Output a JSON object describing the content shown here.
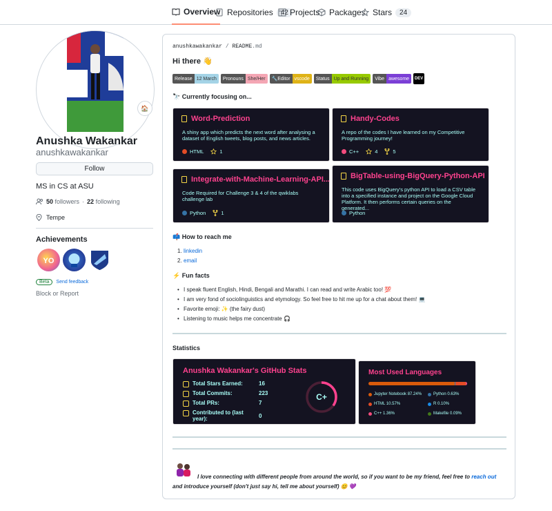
{
  "nav": {
    "tabs": [
      {
        "label": "Overview",
        "icon": "book-icon",
        "count": null
      },
      {
        "label": "Repositories",
        "icon": "repo-icon",
        "count": "42"
      },
      {
        "label": "Projects",
        "icon": "table-icon",
        "count": null
      },
      {
        "label": "Packages",
        "icon": "package-icon",
        "count": null
      },
      {
        "label": "Stars",
        "icon": "star-icon",
        "count": "24"
      }
    ]
  },
  "profile": {
    "name": "Anushka Wakankar",
    "login": "anushkawakankar",
    "follow_label": "Follow",
    "bio": "MS in CS at ASU",
    "followers_count": "50",
    "followers_label": "followers",
    "separator": "·",
    "following_count": "22",
    "following_label": "following",
    "location": "Tempe",
    "achievements_title": "Achievements",
    "beta_label": "Beta",
    "feedback_label": "Send feedback",
    "block_label": "Block or Report",
    "status_emoji": "🏠"
  },
  "readme": {
    "crumb_user": "anushkawakankar",
    "crumb_sep": "/",
    "crumb_file": "README",
    "crumb_ext": ".md",
    "greeting": "Hi there 👋",
    "shields": [
      {
        "left": "Release",
        "right": "12 March",
        "color": "#a4d3e6",
        "text": "#333"
      },
      {
        "left": "Pronouns",
        "right": "She/Her",
        "color": "#f4a6b4",
        "text": "#333"
      },
      {
        "left": "🔧Editor",
        "right": "vscode",
        "color": "#dfb317",
        "text": "#fff"
      },
      {
        "left": "Status",
        "right": "Up and Running",
        "color": "#97ca00",
        "text": "#333"
      },
      {
        "left": "Vibe",
        "right": "awesome",
        "color": "#7b3fd6",
        "text": "#fff"
      }
    ],
    "dev_badge": "DEV",
    "focus_heading": "🔭 Currently focusing on...",
    "reach_heading": "📫 How to reach me",
    "reach_links": [
      "linkedin",
      "email"
    ],
    "fun_heading": "⚡ Fun facts",
    "fun_facts": [
      "I speak fluent English, Hindi, Bengali and Marathi. I can read and write Arabic too! 💯",
      "I am very fond of sociolinguistics and etymology. So feel free to hit me up for a chat about them! 💻",
      "Favorite emoji: ✨ (the fairy dust)",
      "Listening to music helps me concentrate 🎧"
    ],
    "statistics_heading": "Statistics",
    "footer_text": "I love connecting with different people from around the world, so if you want to be my friend, feel free to",
    "footer_link": "reach out",
    "footer_text2": "and introduce yourself (don't just say hi, tell me about yourself) 😊 💜"
  },
  "pinned": [
    {
      "title": "Word-Prediction",
      "desc": "A shiny app which predicts the next word after analysing a dataset of English tweets, blog posts, and news articles.",
      "lang": "HTML",
      "lang_color": "#e34c26",
      "stars": "1",
      "forks": null
    },
    {
      "title": "Handy-Codes",
      "desc": "A repo of the codes I have learned on my Competitive Programming journey!",
      "lang": "C++",
      "lang_color": "#f34b7d",
      "stars": "4",
      "forks": "5"
    },
    {
      "title": "Integrate-with-Machine-Learning-API...",
      "desc": "Code Required for Challenge 3 & 4 of the qwiklabs challenge lab",
      "lang": "Python",
      "lang_color": "#3572A5",
      "stars": null,
      "forks": "1"
    },
    {
      "title": "BigTable-using-BigQuery-Python-API",
      "desc": "This code uses BigQuery's python API to load a CSV table into a specified instance and project on the Google Cloud Platform. It then performs certain queries on the generated...",
      "lang": "Python",
      "lang_color": "#3572A5",
      "stars": null,
      "forks": null
    }
  ],
  "stats": {
    "title": "Anushka Wakankar's GitHub Stats",
    "rows": [
      {
        "label": "Total Stars Earned:",
        "value": "16"
      },
      {
        "label": "Total Commits:",
        "value": "223"
      },
      {
        "label": "Total PRs:",
        "value": "7"
      },
      {
        "label": "Contributed to (last year):",
        "value": "0"
      }
    ],
    "grade": "C+",
    "grade_progress": 0.35
  },
  "languages": {
    "title": "Most Used Languages",
    "items": [
      {
        "label": "Jupyter Notebook 87.24%",
        "pct": 87.24,
        "color": "#DA5B0B"
      },
      {
        "label": "Python 0.63%",
        "pct": 0.63,
        "color": "#3572A5"
      },
      {
        "label": "HTML 10.57%",
        "pct": 10.57,
        "color": "#e34c26"
      },
      {
        "label": "R 0.10%",
        "pct": 0.1,
        "color": "#198CE7"
      },
      {
        "label": "C++ 1.36%",
        "pct": 1.36,
        "color": "#f34b7d"
      },
      {
        "label": "Makefile 0.09%",
        "pct": 0.09,
        "color": "#427819"
      }
    ]
  }
}
